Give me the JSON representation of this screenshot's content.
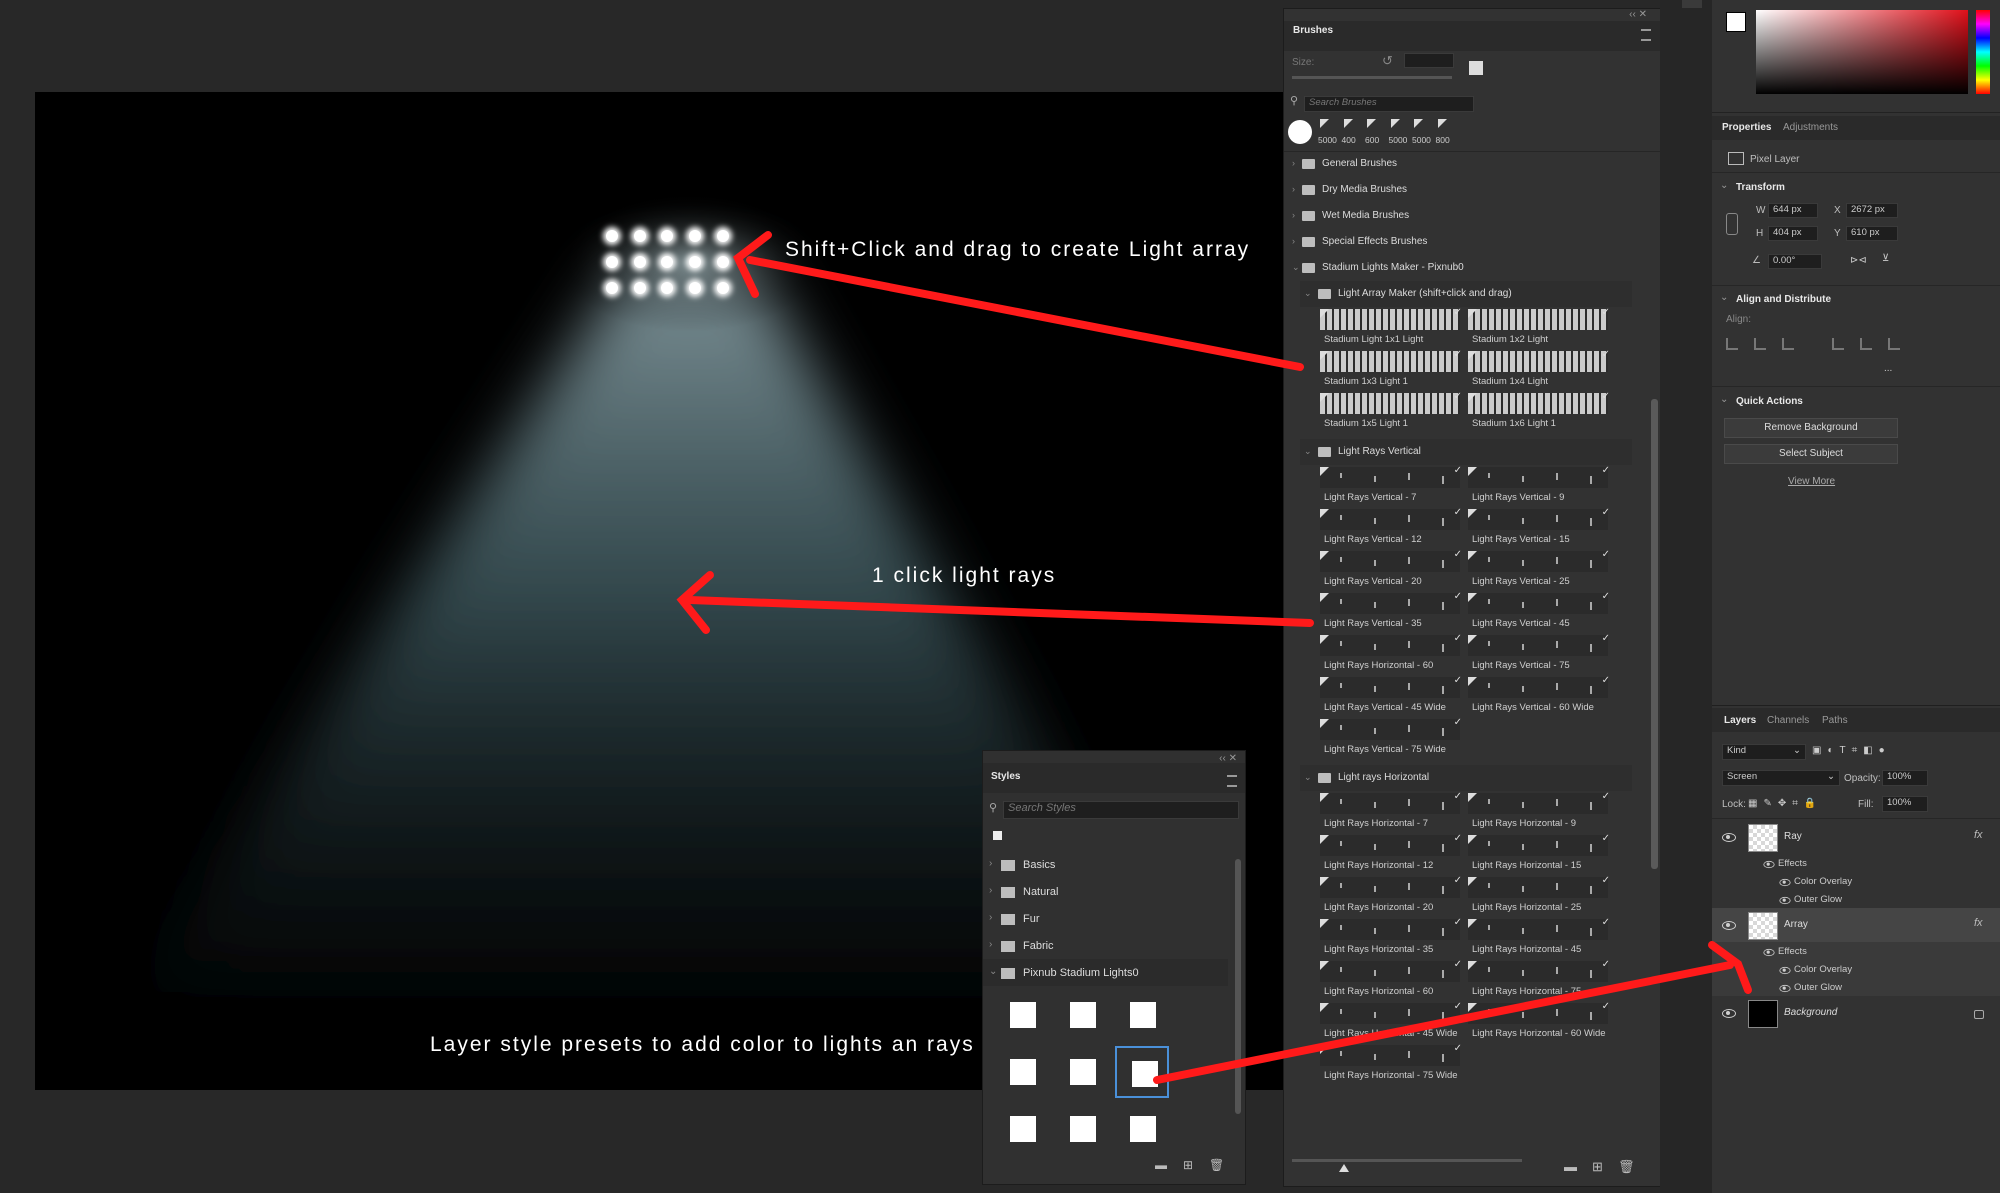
{
  "annotations": {
    "light_array": "Shift+Click and drag to create Light array",
    "light_rays": "1 click light rays",
    "layer_styles": "Layer style presets to add color to lights an rays"
  },
  "brushes_panel": {
    "title": "Brushes",
    "size_label": "Size:",
    "search_placeholder": "Search Brushes",
    "recent_sizes": [
      "5000",
      "400",
      "600",
      "5000",
      "5000",
      "800"
    ],
    "folders": [
      "General Brushes",
      "Dry Media Brushes",
      "Wet Media Brushes",
      "Special Effects Brushes",
      "Stadium Lights Maker - Pixnub0"
    ],
    "subfolder_array": "Light Array Maker (shift+click and drag)",
    "array_brushes": [
      "Stadium Light 1x1 Light",
      "Stadium 1x2 Light",
      "Stadium 1x3 Light 1",
      "Stadium 1x4 Light",
      "Stadium 1x5 Light 1",
      "Stadium 1x6 Light 1"
    ],
    "subfolder_vertical": "Light Rays Vertical",
    "vertical_brushes": [
      "Light Rays Vertical - 7",
      "Light Rays Vertical - 9",
      "Light Rays Vertical - 12",
      "Light Rays Vertical - 15",
      "Light Rays Vertical - 20",
      "Light Rays Vertical - 25",
      "Light Rays Vertical - 35",
      "Light Rays Vertical - 45",
      "Light Rays Horizontal - 60",
      "Light Rays Vertical - 75",
      "Light Rays Vertical - 45 Wide",
      "Light Rays Vertical - 60 Wide",
      "Light Rays Vertical - 75 Wide"
    ],
    "subfolder_horizontal": "Light rays Horizontal",
    "horizontal_brushes": [
      "Light Rays Horizontal - 7",
      "Light Rays Horizontal - 9",
      "Light Rays Horizontal - 12",
      "Light Rays Horizontal - 15",
      "Light Rays Horizontal - 20",
      "Light Rays Horizontal - 25",
      "Light Rays Horizontal - 35",
      "Light Rays Horizontal - 45",
      "Light Rays Horizontal - 60",
      "Light Rays Horizontal - 75",
      "Light Rays Horizontal - 45 Wide",
      "Light Rays Horizontal - 60 Wide",
      "Light Rays Horizontal - 75 Wide"
    ]
  },
  "styles_panel": {
    "title": "Styles",
    "search_placeholder": "Search Styles",
    "folders": [
      "Basics",
      "Natural",
      "Fur",
      "Fabric",
      "Pixnub Stadium Lights0"
    ]
  },
  "properties_panel": {
    "tabs": [
      "Properties",
      "Adjustments"
    ],
    "layer_type": "Pixel Layer",
    "transform_title": "Transform",
    "w_label": "W",
    "w_value": "644 px",
    "h_label": "H",
    "h_value": "404 px",
    "x_label": "X",
    "x_value": "2672 px",
    "y_label": "Y",
    "y_value": "610 px",
    "angle_value": "0.00°",
    "align_title": "Align and Distribute",
    "align_label": "Align:",
    "more": "...",
    "quick_actions_title": "Quick Actions",
    "remove_bg": "Remove Background",
    "select_subject": "Select Subject",
    "view_more": "View More"
  },
  "layers_panel": {
    "tabs": [
      "Layers",
      "Channels",
      "Paths"
    ],
    "kind_label": "Kind",
    "blend_mode": "Screen",
    "opacity_label": "Opacity:",
    "opacity_value": "100%",
    "lock_label": "Lock:",
    "fill_label": "Fill:",
    "fill_value": "100%",
    "layers": [
      {
        "name": "Ray",
        "effects": "Effects",
        "fx1": "Color Overlay",
        "fx2": "Outer Glow"
      },
      {
        "name": "Array",
        "effects": "Effects",
        "fx1": "Color Overlay",
        "fx2": "Outer Glow"
      },
      {
        "name": "Background"
      }
    ],
    "fx_label": "fx"
  },
  "colors": {
    "arrow": "#ff1a1a",
    "panel_bg": "#323232",
    "canvas_bg": "#000000",
    "selection_blue": "#4a90d9"
  }
}
